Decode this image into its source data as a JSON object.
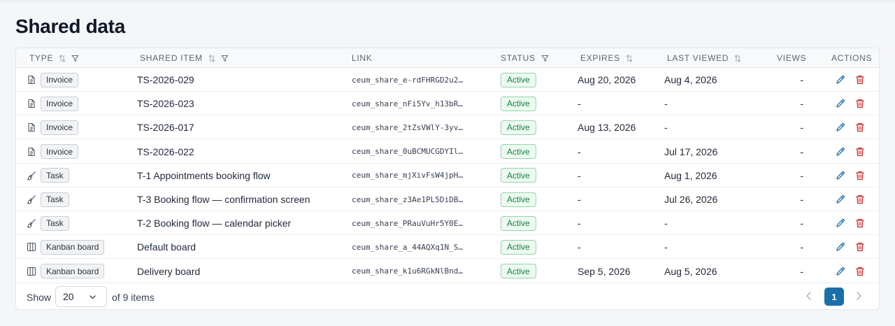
{
  "page": {
    "title": "Shared data"
  },
  "table": {
    "columns": {
      "type": "TYPE",
      "shared_item": "SHARED ITEM",
      "link": "LINK",
      "status": "STATUS",
      "expires": "EXPIRES",
      "last_viewed": "LAST VIEWED",
      "views": "VIEWS",
      "actions": "ACTIONS"
    },
    "rows": [
      {
        "type": "Invoice",
        "type_icon": "document-icon",
        "item": "TS-2026-029",
        "link": "ceum_share_e-rdFHRGD2u2…",
        "status": "Active",
        "expires": "Aug 20, 2026",
        "last_viewed": "Aug 4, 2026",
        "views": "-"
      },
      {
        "type": "Invoice",
        "type_icon": "document-icon",
        "item": "TS-2026-023",
        "link": "ceum_share_nFi5Yv_h13bR…",
        "status": "Active",
        "expires": "-",
        "last_viewed": "-",
        "views": "-"
      },
      {
        "type": "Invoice",
        "type_icon": "document-icon",
        "item": "TS-2026-017",
        "link": "ceum_share_2tZsVWlY-3yv…",
        "status": "Active",
        "expires": "Aug 13, 2026",
        "last_viewed": "-",
        "views": "-"
      },
      {
        "type": "Invoice",
        "type_icon": "document-icon",
        "item": "TS-2026-022",
        "link": "ceum_share_0uBCMUCGDYIl…",
        "status": "Active",
        "expires": "-",
        "last_viewed": "Jul 17, 2026",
        "views": "-"
      },
      {
        "type": "Task",
        "type_icon": "brush-icon",
        "item": "T-1 Appointments booking flow",
        "link": "ceum_share_mjXivFsW4jpH…",
        "status": "Active",
        "expires": "-",
        "last_viewed": "Aug 1, 2026",
        "views": "-"
      },
      {
        "type": "Task",
        "type_icon": "brush-icon",
        "item": "T-3 Booking flow — confirmation screen",
        "link": "ceum_share_z3Ae1PL5DiDB…",
        "status": "Active",
        "expires": "-",
        "last_viewed": "Jul 26, 2026",
        "views": "-"
      },
      {
        "type": "Task",
        "type_icon": "brush-icon",
        "item": "T-2 Booking flow — calendar picker",
        "link": "ceum_share_PRauVuHr5Y0E…",
        "status": "Active",
        "expires": "-",
        "last_viewed": "-",
        "views": "-"
      },
      {
        "type": "Kanban board",
        "type_icon": "columns-icon",
        "item": "Default board",
        "link": "ceum_share_a_44AQXq1N_S…",
        "status": "Active",
        "expires": "-",
        "last_viewed": "-",
        "views": "-"
      },
      {
        "type": "Kanban board",
        "type_icon": "columns-icon",
        "item": "Delivery board",
        "link": "ceum_share_k1u6RGkNlBnd…",
        "status": "Active",
        "expires": "Sep 5, 2026",
        "last_viewed": "Aug 5, 2026",
        "views": "-"
      }
    ]
  },
  "footer": {
    "show_label": "Show",
    "page_size": "20",
    "items_count": "of 9 items",
    "current_page": "1"
  },
  "colors": {
    "status_active": "#15803d",
    "edit_icon": "#1a6fa8",
    "delete_icon": "#d12b2b",
    "pager_active": "#1a6fa8"
  }
}
